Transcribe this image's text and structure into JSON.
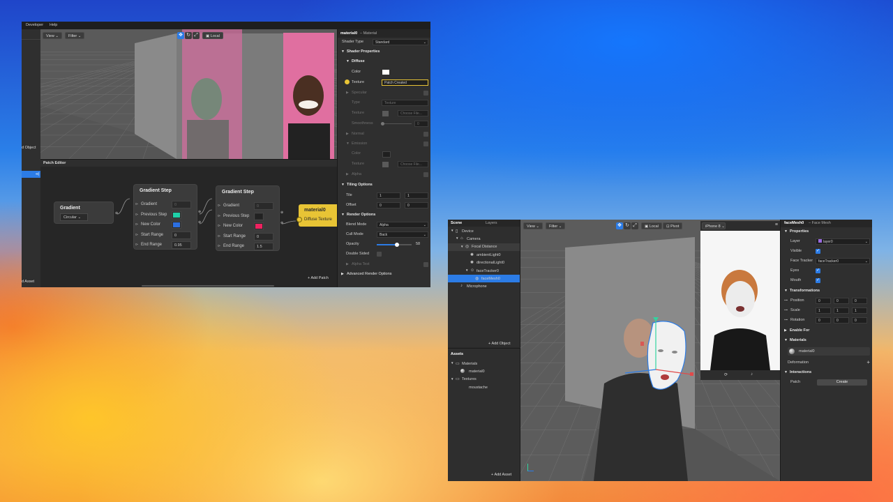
{
  "win1": {
    "menu": [
      "Developer",
      "Help"
    ],
    "viewport": {
      "view_label": "View",
      "filter_label": "Filter",
      "local_label": "Local"
    },
    "left_partial": {
      "object_label": "d Object",
      "asset_label": "d Asset",
      "badge": "⊲|"
    },
    "patch_editor": {
      "title": "Patch Editor",
      "add_patch": "Add Patch",
      "gradient_node": {
        "title": "Gradient",
        "select": "Circular"
      },
      "step1": {
        "title": "Gradient Step",
        "rows": [
          {
            "label": "Gradient",
            "value": "0"
          },
          {
            "label": "Previous Step",
            "color": "#1fd0a8"
          },
          {
            "label": "New Color",
            "color": "#2c6fe0"
          },
          {
            "label": "Start Range",
            "value": "0"
          },
          {
            "label": "End Range",
            "value": "0.95"
          }
        ]
      },
      "step2": {
        "title": "Gradient Step",
        "rows": [
          {
            "label": "Gradient",
            "value": "0"
          },
          {
            "label": "Previous Step",
            "color": "#222222"
          },
          {
            "label": "New Color",
            "color": "#ee2260"
          },
          {
            "label": "Start Range",
            "value": "0"
          },
          {
            "label": "End Range",
            "value": "1.5"
          }
        ]
      },
      "material_node": {
        "title": "material0",
        "port": "Diffuse Texture",
        "color": "#e8c435"
      }
    },
    "inspector": {
      "header_name": "material0",
      "header_type": "– Material",
      "shader_type_label": "Shader Type",
      "shader_type_value": "Standard",
      "shader_properties": "Shader Properties",
      "diffuse": "Diffuse",
      "color_label": "Color",
      "texture_label": "Texture",
      "texture_value": "Patch Created",
      "specular": "Specular",
      "type_label": "Type",
      "type_value": "Texture",
      "spec_texture_label": "Texture",
      "choose_file": "Choose File...",
      "smoothness_label": "Smoothness",
      "smoothness_value": "0",
      "normal": "Normal",
      "emission": "Emission",
      "em_color_label": "Color",
      "em_texture_label": "Texture",
      "em_choose_file": "Choose File...",
      "alpha": "Alpha",
      "tiling_options": "Tiling Options",
      "tile_label": "Tile",
      "tile_x": "1",
      "tile_y": "1",
      "offset_label": "Offset",
      "offset_x": "0",
      "offset_y": "0",
      "render_options": "Render Options",
      "blend_mode_label": "Blend Mode",
      "blend_mode_value": "Alpha",
      "cull_mode_label": "Cull Mode",
      "cull_mode_value": "Back",
      "opacity_label": "Opacity",
      "opacity_value": "58",
      "opacity_fraction": 0.58,
      "double_sided_label": "Double Sided",
      "alpha_test": "Alpha Test",
      "advanced_render": "Advanced Render Options"
    }
  },
  "win2": {
    "scene": {
      "tab_scene": "Scene",
      "tab_layers": "Layers",
      "items": [
        {
          "label": "Device",
          "depth": 0,
          "icon": "device-icon"
        },
        {
          "label": "Camera",
          "depth": 1,
          "icon": "camera-icon"
        },
        {
          "label": "Focal Distance",
          "depth": 2,
          "icon": "focal-icon"
        },
        {
          "label": "ambientLight0",
          "depth": 3,
          "icon": "light-icon"
        },
        {
          "label": "directionalLight0",
          "depth": 3,
          "icon": "light-icon"
        },
        {
          "label": "faceTracker0",
          "depth": 3,
          "icon": "tracker-icon"
        },
        {
          "label": "faceMesh0",
          "depth": 4,
          "icon": "mesh-icon",
          "selected": true
        },
        {
          "label": "Microphone",
          "depth": 1,
          "icon": "mic-icon"
        }
      ],
      "add_object": "Add Object"
    },
    "assets": {
      "title": "Assets",
      "items": [
        {
          "label": "Materials",
          "depth": 0
        },
        {
          "label": "material0",
          "depth": 1
        },
        {
          "label": "Textures",
          "depth": 0
        },
        {
          "label": "moustache",
          "depth": 1
        }
      ],
      "add_asset": "Add Asset"
    },
    "viewport": {
      "view_label": "View",
      "filter_label": "Filter",
      "local_label": "Local",
      "pivot_label": "Pivot",
      "device_label": "iPhone 8"
    },
    "inspector": {
      "header_name": "faceMesh0",
      "header_type": "– Face Mesh",
      "properties": "Properties",
      "layer_label": "Layer",
      "layer_value": "layer0",
      "visible_label": "Visible",
      "face_tracker_label": "Face Tracker",
      "face_tracker_value": "faceTracker0",
      "eyes_label": "Eyes",
      "mouth_label": "Mouth",
      "transformations": "Transformations",
      "position_label": "Position",
      "position": [
        "0",
        "0",
        "0"
      ],
      "scale_label": "Scale",
      "scale": [
        "1",
        "1",
        "1"
      ],
      "rotation_label": "Rotation",
      "rotation": [
        "0",
        "0",
        "0"
      ],
      "enable_for": "Enable For",
      "materials": "Materials",
      "material_value": "material0",
      "deformation": "Deformation",
      "interactions": "Interactions",
      "patch_label": "Patch",
      "create_label": "Create"
    }
  }
}
